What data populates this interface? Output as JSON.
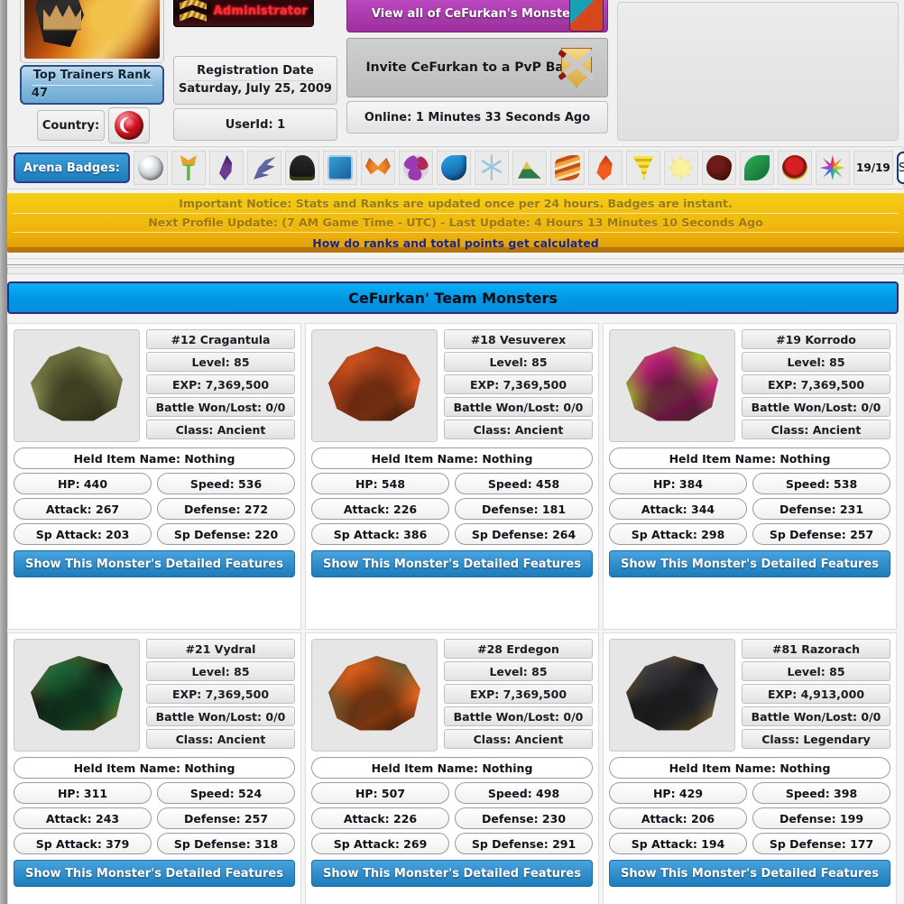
{
  "profile": {
    "rank": {
      "label": "Top Trainers Rank",
      "value": "47"
    },
    "country": {
      "label": "Country:",
      "flag": "turkey-flag-icon"
    },
    "admin_badge": "Administrator",
    "registration": {
      "label": "Registration Date",
      "value": "Saturday, July 25, 2009"
    },
    "userid": "UserId:  1",
    "view_all": "View all of CeFurkan's Monsters",
    "pvp_invite": "Invite CeFurkan to a PvP Battle",
    "online": "Online: 1 Minutes 33 Seconds Ago"
  },
  "badges": {
    "label": "Arena Badges:",
    "count": "19/19",
    "show": "Show",
    "items": [
      {
        "name": "badge-grey-orb",
        "c1": "#cfd6dc",
        "c2": "#8e9aa6",
        "shape": "orb"
      },
      {
        "name": "badge-green-flower",
        "c1": "#56b93a",
        "c2": "#e8a22a",
        "shape": "flower"
      },
      {
        "name": "badge-purple-swirl",
        "c1": "#6d3b8f",
        "c2": "#3d1d55",
        "shape": "swirl"
      },
      {
        "name": "badge-blue-feather",
        "c1": "#7d88c4",
        "c2": "#3a4280",
        "shape": "feather"
      },
      {
        "name": "badge-dark-ghost",
        "c1": "#2a2a2a",
        "c2": "#e8d318",
        "shape": "ghost"
      },
      {
        "name": "badge-blue-square",
        "c1": "#2f9fd8",
        "c2": "#1d5f98",
        "shape": "square"
      },
      {
        "name": "badge-orange-butterfly",
        "c1": "#f08a2a",
        "c2": "#b4420d",
        "shape": "butterfly"
      },
      {
        "name": "badge-purple-cells",
        "c1": "#9b39b0",
        "c2": "#b02a54",
        "shape": "cells"
      },
      {
        "name": "badge-blue-wave",
        "c1": "#2aa8ea",
        "c2": "#0f4f94",
        "shape": "wave"
      },
      {
        "name": "badge-white-snowflake",
        "c1": "#e7f3fb",
        "c2": "#9dc5e0",
        "shape": "snow"
      },
      {
        "name": "badge-mountain",
        "c1": "#e3c04a",
        "c2": "#2e7a4a",
        "shape": "mountain"
      },
      {
        "name": "badge-orange-strata",
        "c1": "#f0a23a",
        "c2": "#c2501a",
        "shape": "strata"
      },
      {
        "name": "badge-red-flame",
        "c1": "#f25c1f",
        "c2": "#a51a0c",
        "shape": "flame"
      },
      {
        "name": "badge-yellow-cyclone",
        "c1": "#f6e343",
        "c2": "#d6b609",
        "shape": "cyclone"
      },
      {
        "name": "badge-yellow-sun",
        "c1": "#fbf0a0",
        "c2": "#e8cf3c",
        "shape": "sun"
      },
      {
        "name": "badge-dark-red-rock",
        "c1": "#6e1b16",
        "c2": "#2b0806",
        "shape": "rock"
      },
      {
        "name": "badge-green-leaf",
        "c1": "#2fae59",
        "c2": "#0f6b31",
        "shape": "leaf"
      },
      {
        "name": "badge-red-eclipse",
        "c1": "#d81f1f",
        "c2": "#f4dd4a",
        "shape": "eclipse"
      },
      {
        "name": "badge-rainbow-star",
        "c1": "#e23b3b",
        "c2": "#3b7be2",
        "shape": "star"
      }
    ]
  },
  "notice": {
    "line1": "Important Notice: Stats and Ranks are updated once per 24 hours. Badges are instant.",
    "line2": "Next Profile Update: (7 AM Game Time - UTC) - Last Update: 4 Hours 13 Minutes 10 Seconds Ago",
    "line3": "How do ranks and total points get calculated"
  },
  "team": {
    "title": "CeFurkan' Team Monsters",
    "detail_button": "Show This Monster's Detailed Features",
    "monsters": [
      {
        "name": "#12 Cragantula",
        "level": "Level: 85",
        "exp": "EXP: 7,369,500",
        "battle": "Battle Won/Lost: 0/0",
        "class": "Class: Ancient",
        "held": "Held Item Name: Nothing",
        "hp": "HP: 440",
        "speed": "Speed: 536",
        "attack": "Attack: 267",
        "defense": "Defense: 272",
        "sp_attack": "Sp Attack: 203",
        "sp_defense": "Sp Defense: 220",
        "art": "spider-monster-image",
        "c1": "#8f9257",
        "c2": "#3c3a24",
        "c3": "#6c6f3c"
      },
      {
        "name": "#18 Vesuverex",
        "level": "Level: 85",
        "exp": "EXP: 7,369,500",
        "battle": "Battle Won/Lost: 0/0",
        "class": "Class: Ancient",
        "held": "Held Item Name: Nothing",
        "hp": "HP: 548",
        "speed": "Speed: 458",
        "attack": "Attack: 226",
        "defense": "Defense: 181",
        "sp_attack": "Sp Attack: 386",
        "sp_defense": "Sp Defense: 264",
        "art": "red-beast-monster-image",
        "c1": "#a33916",
        "c2": "#2d1008",
        "c3": "#d4561f"
      },
      {
        "name": "#19 Korrodo",
        "level": "Level: 85",
        "exp": "EXP: 7,369,500",
        "battle": "Battle Won/Lost: 0/0",
        "class": "Class: Ancient",
        "held": "Held Item Name: Nothing",
        "hp": "HP: 384",
        "speed": "Speed: 538",
        "attack": "Attack: 344",
        "defense": "Defense: 231",
        "sp_attack": "Sp Attack: 298",
        "sp_defense": "Sp Defense: 257",
        "art": "green-dragon-monster-image",
        "c1": "#9ec42a",
        "c2": "#3c5a16",
        "c3": "#c4247a"
      },
      {
        "name": "#21 Vydral",
        "level": "Level: 85",
        "exp": "EXP: 7,369,500",
        "battle": "Battle Won/Lost: 0/0",
        "class": "Class: Ancient",
        "held": "Held Item Name: Nothing",
        "hp": "HP: 311",
        "speed": "Speed: 524",
        "attack": "Attack: 243",
        "defense": "Defense: 257",
        "sp_attack": "Sp Attack: 379",
        "sp_defense": "Sp Defense: 318",
        "art": "hydra-monster-image",
        "c1": "#141414",
        "c2": "#c88e18",
        "c3": "#1f6b3a"
      },
      {
        "name": "#28 Erdegon",
        "level": "Level: 85",
        "exp": "EXP: 7,369,500",
        "battle": "Battle Won/Lost: 0/0",
        "class": "Class: Ancient",
        "held": "Held Item Name: Nothing",
        "hp": "HP: 507",
        "speed": "Speed: 498",
        "attack": "Attack: 226",
        "defense": "Defense: 230",
        "sp_attack": "Sp Attack: 269",
        "sp_defense": "Sp Defense: 291",
        "art": "magma-beast-monster-image",
        "c1": "#6a5a32",
        "c2": "#22180c",
        "c3": "#e2621a"
      },
      {
        "name": "#81 Razorach",
        "level": "Level: 85",
        "exp": "EXP: 4,913,000",
        "battle": "Battle Won/Lost: 0/0",
        "class": "Class: Legendary",
        "held": "Held Item Name: Nothing",
        "hp": "HP: 429",
        "speed": "Speed: 398",
        "attack": "Attack: 206",
        "defense": "Defense: 199",
        "sp_attack": "Sp Attack: 194",
        "sp_defense": "Sp Defense: 177",
        "art": "black-gold-wolf-monster-image",
        "c1": "#17171a",
        "c2": "#d99a20",
        "c3": "#3a3a40"
      }
    ]
  }
}
